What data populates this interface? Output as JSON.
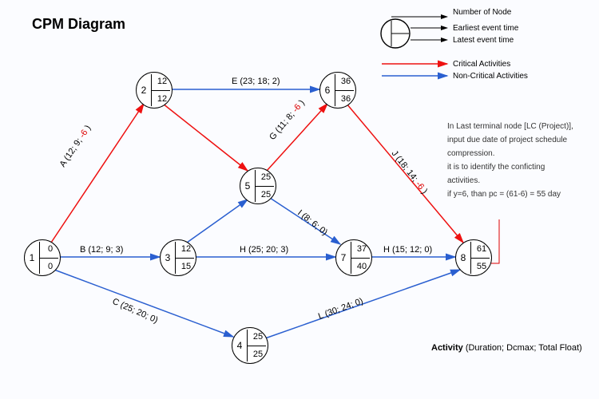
{
  "title": "CPM Diagram",
  "legend": {
    "node_number": "Number of Node",
    "earliest": "Earliest event time",
    "latest": "Latest event time",
    "critical": "Critical Activities",
    "noncritical": "Non-Critical Activities"
  },
  "footer_label": "Activity",
  "footer_spec": "(Duration; Dcmax; Total Float)",
  "side_note": {
    "l1": "In Last terminal node [LC (Project)],",
    "l2": "input due date of project schedule",
    "l3": "compression.",
    "l4": "it is to identify the conficting",
    "l5": "activities.",
    "l6": "if y=6, than pc = (61-6) = 55 day"
  },
  "nodes": {
    "1": {
      "et": "0",
      "lt": "0"
    },
    "2": {
      "et": "12",
      "lt": "12"
    },
    "3": {
      "et": "12",
      "lt": "15"
    },
    "4": {
      "et": "25",
      "lt": "25"
    },
    "5": {
      "et": "25",
      "lt": "25"
    },
    "6": {
      "et": "36",
      "lt": "36"
    },
    "7": {
      "et": "37",
      "lt": "40"
    },
    "8": {
      "et": "61",
      "lt": "55"
    }
  },
  "activities": {
    "A": "A (12; 9; -6 )",
    "B": "B (12; 9; 3)",
    "C": "C (25; 20; 0)",
    "E": "E (23; 18; 2)",
    "G": "G (11; 8; -6 )",
    "H1": "H (25; 20; 3)",
    "H2": "H (15; 12; 0)",
    "I": "I (8; 6; 0)",
    "J": "J (18; 14; -6 )",
    "L": "L (30; 24; 0)"
  },
  "chart_data": {
    "type": "network-diagram",
    "method": "CPM",
    "node_fields": [
      "id",
      "earliest_event_time",
      "latest_event_time"
    ],
    "nodes": [
      {
        "id": 1,
        "et": 0,
        "lt": 0
      },
      {
        "id": 2,
        "et": 12,
        "lt": 12
      },
      {
        "id": 3,
        "et": 12,
        "lt": 15
      },
      {
        "id": 4,
        "et": 25,
        "lt": 25
      },
      {
        "id": 5,
        "et": 25,
        "lt": 25
      },
      {
        "id": 6,
        "et": 36,
        "lt": 36
      },
      {
        "id": 7,
        "et": 37,
        "lt": 40
      },
      {
        "id": 8,
        "et": 61,
        "lt": 55
      }
    ],
    "activity_fields": [
      "name",
      "from",
      "to",
      "duration",
      "dcmax",
      "total_float",
      "critical"
    ],
    "activities": [
      {
        "name": "A",
        "from": 1,
        "to": 2,
        "duration": 12,
        "dcmax": 9,
        "total_float": -6,
        "critical": true
      },
      {
        "name": "B",
        "from": 1,
        "to": 3,
        "duration": 12,
        "dcmax": 9,
        "total_float": 3,
        "critical": false
      },
      {
        "name": "C",
        "from": 1,
        "to": 4,
        "duration": 25,
        "dcmax": 20,
        "total_float": 0,
        "critical": false
      },
      {
        "name": "E",
        "from": 2,
        "to": 6,
        "duration": 23,
        "dcmax": 18,
        "total_float": 2,
        "critical": false
      },
      {
        "name": "G",
        "from": 5,
        "to": 6,
        "duration": 11,
        "dcmax": 8,
        "total_float": -6,
        "critical": true
      },
      {
        "name": "H",
        "from": 3,
        "to": 7,
        "duration": 25,
        "dcmax": 20,
        "total_float": 3,
        "critical": false
      },
      {
        "name": "H",
        "from": 7,
        "to": 8,
        "duration": 15,
        "dcmax": 12,
        "total_float": 0,
        "critical": false
      },
      {
        "name": "I",
        "from": 5,
        "to": 7,
        "duration": 8,
        "dcmax": 6,
        "total_float": 0,
        "critical": false
      },
      {
        "name": "J",
        "from": 6,
        "to": 8,
        "duration": 18,
        "dcmax": 14,
        "total_float": -6,
        "critical": true
      },
      {
        "name": "L",
        "from": 4,
        "to": 8,
        "duration": 30,
        "dcmax": 24,
        "total_float": 0,
        "critical": false
      }
    ],
    "implicit_arcs": [
      {
        "from": 2,
        "to": 5,
        "critical": true
      },
      {
        "from": 3,
        "to": 5,
        "critical": false
      }
    ]
  }
}
